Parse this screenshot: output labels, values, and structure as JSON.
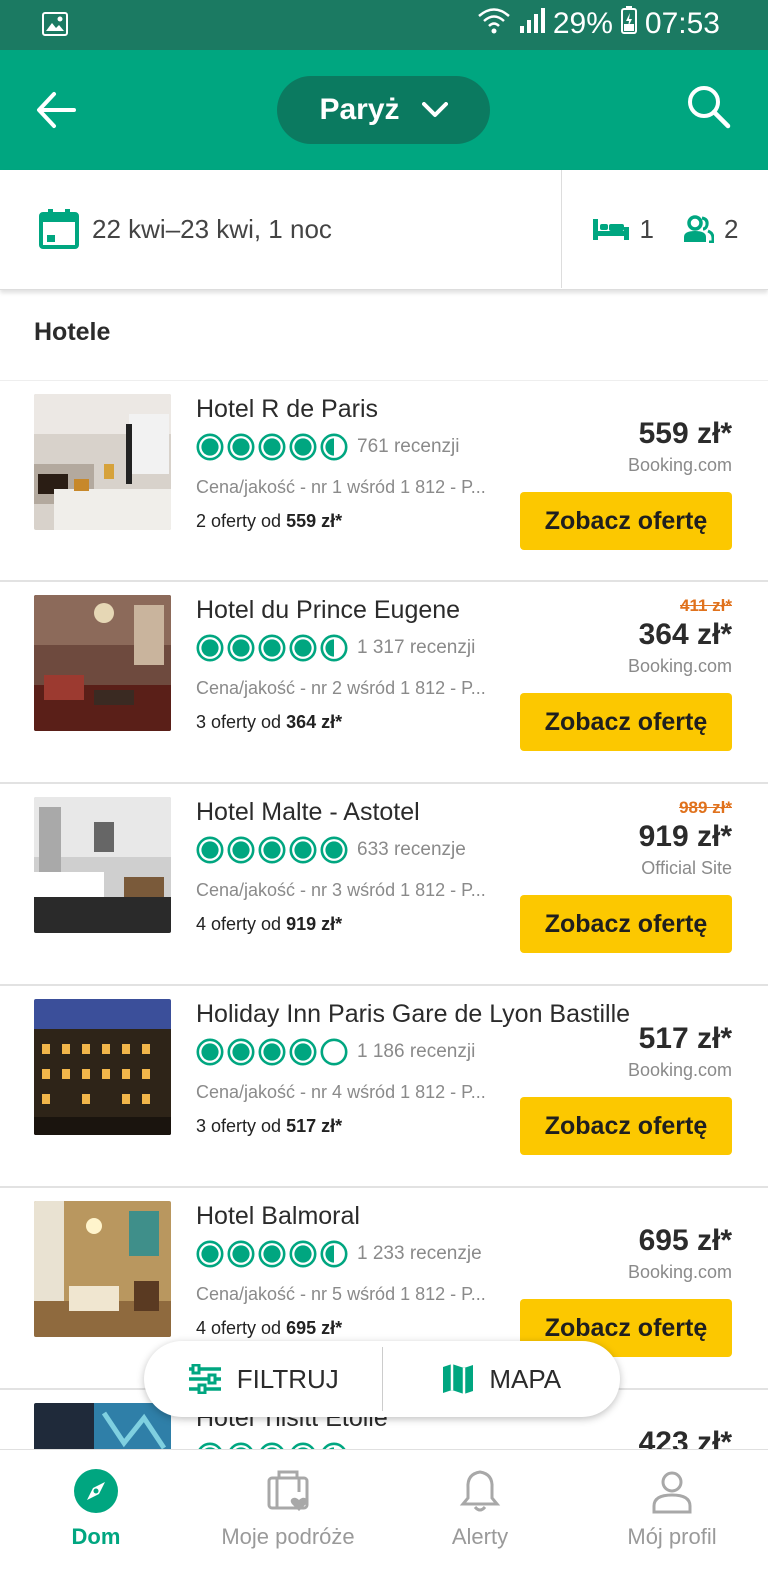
{
  "status_bar": {
    "battery": "29%",
    "time": "07:53"
  },
  "app_bar": {
    "city": "Paryż"
  },
  "trip": {
    "dates": "22 kwi–23 kwi, 1 noc",
    "rooms": "1",
    "guests": "2"
  },
  "section_title": "Hotele",
  "hotels": [
    {
      "name": "Hotel R de Paris",
      "rating": 4.5,
      "reviews": "761 recenzji",
      "ranking": "Cena/jakość - nr 1 wśród 1 812 - P...",
      "offers_prefix": "2 oferty od ",
      "offers_price": "559 zł*",
      "old_price": "",
      "price": "559 zł*",
      "provider": "Booking.com",
      "button": "Zobacz ofertę"
    },
    {
      "name": "Hotel du Prince Eugene",
      "rating": 4.5,
      "reviews": "1 317 recenzji",
      "ranking": "Cena/jakość - nr 2 wśród 1 812 - P...",
      "offers_prefix": "3 oferty od ",
      "offers_price": "364 zł*",
      "old_price": "411 zł*",
      "price": "364 zł*",
      "provider": "Booking.com",
      "button": "Zobacz ofertę"
    },
    {
      "name": "Hotel Malte - Astotel",
      "rating": 5,
      "reviews": "633 recenzje",
      "ranking": "Cena/jakość - nr 3 wśród 1 812 - P...",
      "offers_prefix": "4 oferty od ",
      "offers_price": "919 zł*",
      "old_price": "989 zł*",
      "price": "919 zł*",
      "provider": "Official Site",
      "button": "Zobacz ofertę"
    },
    {
      "name": "Holiday Inn Paris Gare de Lyon Bastille",
      "rating": 4,
      "reviews": "1 186 recenzji",
      "ranking": "Cena/jakość - nr 4 wśród 1 812 - P...",
      "offers_prefix": "3 oferty od ",
      "offers_price": "517 zł*",
      "old_price": "",
      "price": "517 zł*",
      "provider": "Booking.com",
      "button": "Zobacz ofertę"
    },
    {
      "name": "Hotel Balmoral",
      "rating": 4.5,
      "reviews": "1 233 recenzje",
      "ranking": "Cena/jakość - nr 5 wśród 1 812 - P...",
      "offers_prefix": "4 oferty od ",
      "offers_price": "695 zł*",
      "old_price": "",
      "price": "695 zł*",
      "provider": "Booking.com",
      "button": "Zobacz ofertę"
    },
    {
      "name": "Hotel Tilsitt Etoile",
      "rating": 4.5,
      "reviews": "",
      "ranking": "",
      "offers_prefix": "",
      "offers_price": "",
      "old_price": "",
      "price": "423 zł*",
      "provider": "",
      "button": ""
    }
  ],
  "float_actions": {
    "filter": "FILTRUJ",
    "map": "MAPA"
  },
  "bottom_nav": [
    {
      "label": "Dom",
      "icon": "compass-icon",
      "active": true
    },
    {
      "label": "Moje podróże",
      "icon": "trips-icon",
      "active": false
    },
    {
      "label": "Alerty",
      "icon": "bell-icon",
      "active": false
    },
    {
      "label": "Mój profil",
      "icon": "profile-icon",
      "active": false
    }
  ],
  "colors": {
    "brand": "#00a680",
    "brand_dark": "#1b7a62",
    "cta": "#fcc800",
    "strike": "#e0721d"
  }
}
